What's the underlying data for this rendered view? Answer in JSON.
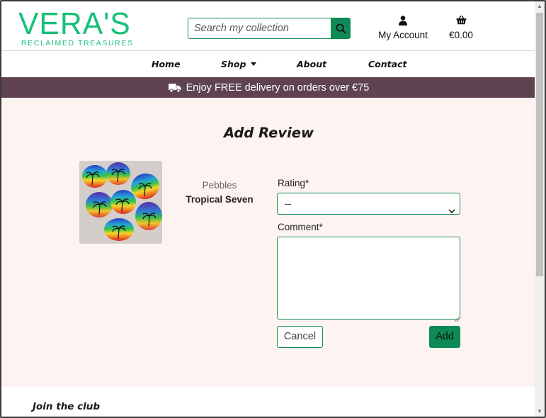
{
  "brand": {
    "name": "VERA'S",
    "tagline": "RECLAIMED TREASURES",
    "color": "#17c07a"
  },
  "search": {
    "placeholder": "Search my collection"
  },
  "header": {
    "account_label": "My Account",
    "bag_total": "€0.00"
  },
  "nav": {
    "items": [
      {
        "label": "Home"
      },
      {
        "label": "Shop"
      },
      {
        "label": "About"
      },
      {
        "label": "Contact"
      }
    ]
  },
  "banner": {
    "text": "Enjoy FREE delivery on orders over €75",
    "color": "#5f4350"
  },
  "page": {
    "title": "Add Review"
  },
  "product": {
    "category": "Pebbles",
    "name": "Tropical Seven"
  },
  "form": {
    "rating_label": "Rating*",
    "rating_value": "--",
    "comment_label": "Comment*",
    "comment_value": "",
    "cancel_label": "Cancel",
    "add_label": "Add"
  },
  "footer": {
    "title": "Join the club"
  },
  "colors": {
    "accent": "#0d8a55",
    "main_bg": "#fdf3f0"
  }
}
